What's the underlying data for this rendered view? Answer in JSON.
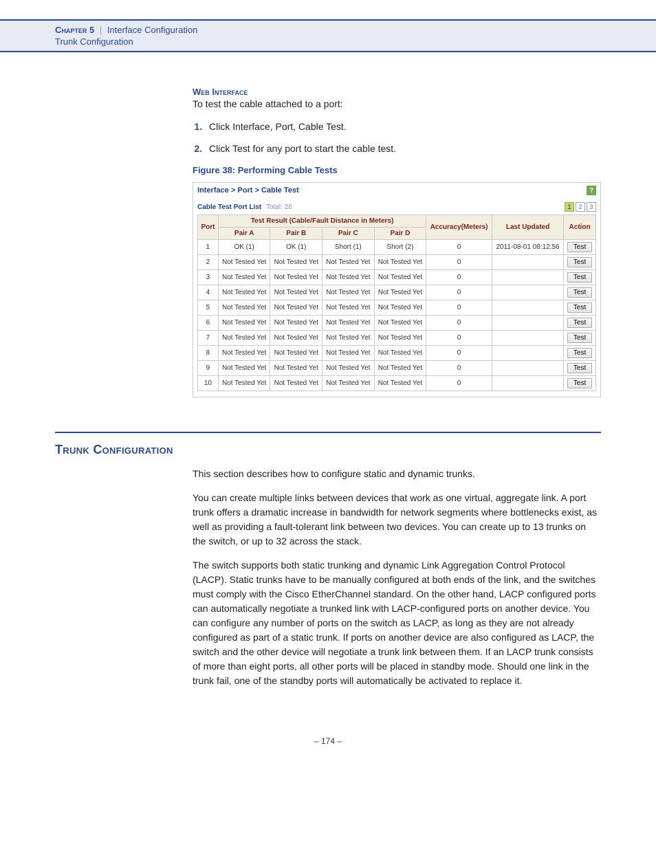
{
  "header": {
    "chapter_label": "Chapter 5",
    "separator": "|",
    "chapter_title": "Interface Configuration",
    "subtitle": "Trunk Configuration"
  },
  "web_interface": {
    "heading": "Web Interface",
    "intro": "To test the cable attached to a port:",
    "steps": [
      "Click Interface, Port, Cable Test.",
      "Click Test for any port to start the cable test."
    ],
    "figure_caption": "Figure 38:  Performing Cable Tests"
  },
  "figure": {
    "breadcrumb": "Interface > Port > Cable Test",
    "help_icon": "?",
    "list_label": "Cable Test Port List",
    "total_label": "Total: 26",
    "pages": [
      "1",
      "2",
      "3"
    ],
    "active_page": 0,
    "columns": {
      "port": "Port",
      "group": "Test Result (Cable/Fault Distance in Meters)",
      "pairA": "Pair A",
      "pairB": "Pair B",
      "pairC": "Pair C",
      "pairD": "Pair D",
      "accuracy": "Accuracy(Meters)",
      "updated": "Last Updated",
      "action": "Action"
    },
    "action_label": "Test",
    "rows": [
      {
        "port": "1",
        "a": "OK (1)",
        "b": "OK (1)",
        "c": "Short (1)",
        "d": "Short (2)",
        "acc": "0",
        "upd": "2011-08-01 08:12:56"
      },
      {
        "port": "2",
        "a": "Not Tested Yet",
        "b": "Not Tested Yet",
        "c": "Not Tested Yet",
        "d": "Not Tested Yet",
        "acc": "0",
        "upd": ""
      },
      {
        "port": "3",
        "a": "Not Tested Yet",
        "b": "Not Tested Yet",
        "c": "Not Tested Yet",
        "d": "Not Tested Yet",
        "acc": "0",
        "upd": ""
      },
      {
        "port": "4",
        "a": "Not Tested Yet",
        "b": "Not Tested Yet",
        "c": "Not Tested Yet",
        "d": "Not Tested Yet",
        "acc": "0",
        "upd": ""
      },
      {
        "port": "5",
        "a": "Not Tested Yet",
        "b": "Not Tested Yet",
        "c": "Not Tested Yet",
        "d": "Not Tested Yet",
        "acc": "0",
        "upd": ""
      },
      {
        "port": "6",
        "a": "Not Tested Yet",
        "b": "Not Tested Yet",
        "c": "Not Tested Yet",
        "d": "Not Tested Yet",
        "acc": "0",
        "upd": ""
      },
      {
        "port": "7",
        "a": "Not Tested Yet",
        "b": "Not Tested Yet",
        "c": "Not Tested Yet",
        "d": "Not Tested Yet",
        "acc": "0",
        "upd": ""
      },
      {
        "port": "8",
        "a": "Not Tested Yet",
        "b": "Not Tested Yet",
        "c": "Not Tested Yet",
        "d": "Not Tested Yet",
        "acc": "0",
        "upd": ""
      },
      {
        "port": "9",
        "a": "Not Tested Yet",
        "b": "Not Tested Yet",
        "c": "Not Tested Yet",
        "d": "Not Tested Yet",
        "acc": "0",
        "upd": ""
      },
      {
        "port": "10",
        "a": "Not Tested Yet",
        "b": "Not Tested Yet",
        "c": "Not Tested Yet",
        "d": "Not Tested Yet",
        "acc": "0",
        "upd": ""
      }
    ]
  },
  "trunk": {
    "heading": "Trunk Configuration",
    "p1": "This section describes how to configure static and dynamic trunks.",
    "p2": "You can create multiple links between devices that work as one virtual, aggregate link. A port trunk offers a dramatic increase in bandwidth for network segments where bottlenecks exist, as well as providing a fault-tolerant link between two devices. You can create up to 13 trunks on the switch, or up to 32 across the stack.",
    "p3": "The switch supports both static trunking and dynamic Link Aggregation Control Protocol (LACP). Static trunks have to be manually configured at both ends of the link, and the switches must comply with the Cisco EtherChannel standard. On the other hand, LACP configured ports can automatically negotiate a trunked link with LACP-configured ports on another device. You can configure any number of ports on the switch as LACP, as long as they are not already configured as part of a static trunk. If ports on another device are also configured as LACP, the switch and the other device will negotiate a trunk link between them. If an LACP trunk consists of more than eight ports, all other ports will be placed in standby mode. Should one link in the trunk fail, one of the standby ports will automatically be activated to replace it."
  },
  "page_number": "– 174 –"
}
